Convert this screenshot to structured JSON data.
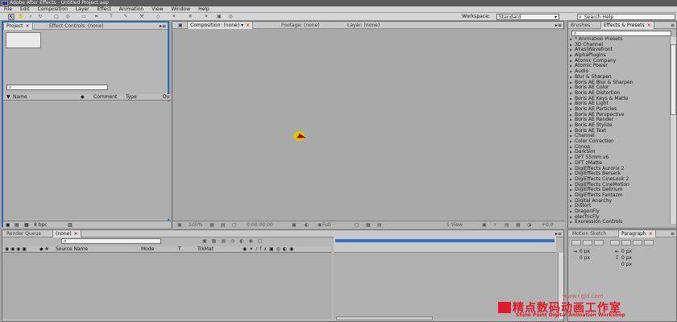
{
  "app": {
    "title": "Adobe After Effects - Untitled Project.aep"
  },
  "menu": [
    "File",
    "Edit",
    "Composition",
    "Layer",
    "Effect",
    "Animation",
    "View",
    "Window",
    "Help"
  ],
  "workspace": {
    "label": "Workspace:",
    "value": "Standard"
  },
  "help": {
    "placeholder": "Search Help"
  },
  "project": {
    "tabs": [
      "Project",
      "Effect Controls: (none)"
    ],
    "search_placeholder": "⌕",
    "columns": [
      "Name",
      "Comment",
      "Type",
      "Du"
    ],
    "footer": {
      "bpc": "8 bpc"
    }
  },
  "composition": {
    "tabs": [
      "Composition: (none)",
      "Footage: (none)",
      "Layer: (none)"
    ],
    "footer": {
      "zoom": "100%",
      "timecode": "0:00:00:00",
      "res": "Full",
      "view": "1 View",
      "offset": "+0.0"
    }
  },
  "effects": {
    "tabs": [
      "Brushes",
      "Effects & Presets"
    ],
    "search_placeholder": "⌕",
    "items": [
      "* Animation Presets",
      "3D Channel",
      "Alias|Wavefront",
      "AlphaPlugins",
      "Atomic Company",
      "Atomic Power",
      "Audio",
      "Blur & Sharpen",
      "Boris AE Blur & Sharpen",
      "Boris AE Color",
      "Boris AE Distortion",
      "Boris AE Keys & Matte",
      "Boris AE Light",
      "Boris AE Particles",
      "Boris AE Perspective",
      "Boris AE Render",
      "Boris AE Stylize",
      "Boris AE Text",
      "Channel",
      "Color Correction",
      "Conoa",
      "DarkSim",
      "DFT 55mm v6",
      "DFT zMatte",
      "DigiEffects Aurorix 2",
      "DigiEffects Berserk",
      "DigiEffects CineLook 2",
      "DigiEffects CineMotion",
      "DigiEffects Delirium",
      "DigiEffects Fantazm",
      "Digital Anarchy",
      "Distort",
      "DragonFly",
      "elecfricFly",
      "Expression Controls"
    ]
  },
  "timeline": {
    "tabs": [
      "Render Queue",
      "(none)"
    ],
    "columns": [
      "Source Name",
      "Mode",
      "T",
      "TrkMat"
    ],
    "search_placeholder": "⌕"
  },
  "paragraph": {
    "tabs": [
      "Motion Sketch",
      "Paragraph"
    ],
    "values": [
      "0 px",
      "0 px",
      "0 px",
      "0 px",
      "0 px"
    ]
  },
  "watermark": {
    "title": "精点数码动画工作室",
    "subtitle": "Shine Point Digital Animation Workshop",
    "url": "www.cgjd.com"
  },
  "colors": {
    "accent": "#2a6bb3",
    "timeline_range": "#3574c4",
    "close_x": "#a00000",
    "watermark": "#e0192b"
  }
}
